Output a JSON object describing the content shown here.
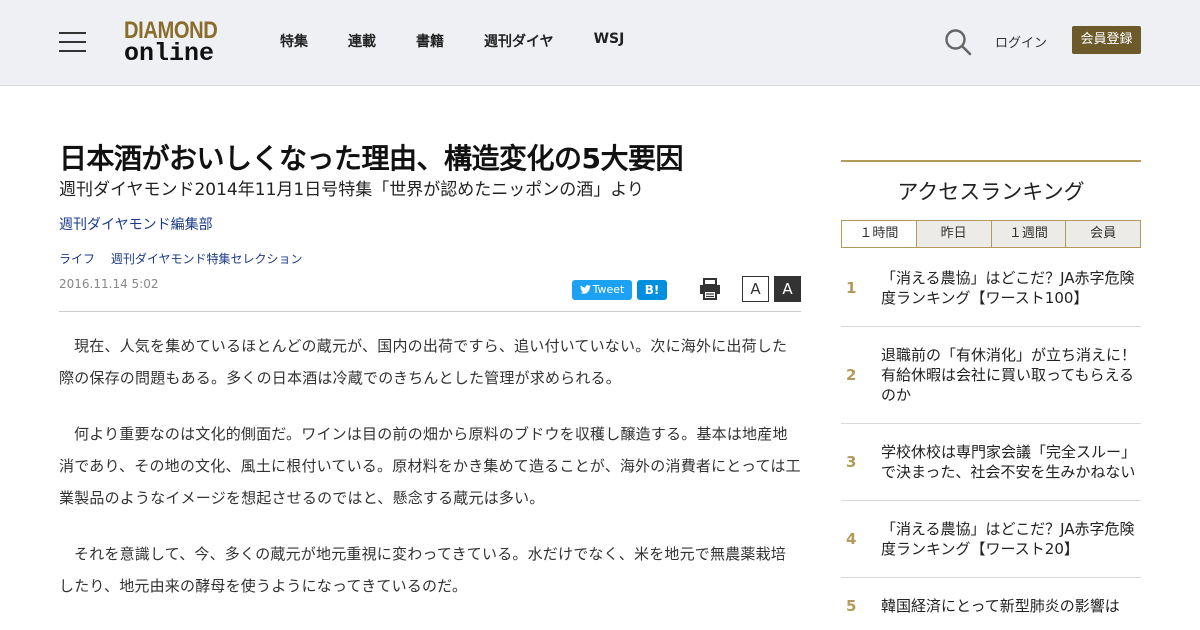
{
  "header": {
    "logo_top": "DIAMOND",
    "logo_bottom": "online",
    "nav": [
      "特集",
      "連載",
      "書籍",
      "週刊ダイヤ",
      "WSJ"
    ],
    "login": "ログイン",
    "register": "会員登録"
  },
  "article": {
    "title": "日本酒がおいしくなった理由、構造変化の5大要因",
    "subtitle": "週刊ダイヤモンド2014年11月1日号特集「世界が認めたニッポンの酒」より",
    "author": "週刊ダイヤモンド編集部",
    "categories": [
      "ライフ",
      "週刊ダイヤモンド特集セレクション"
    ],
    "date": "2016.11.14 5:02",
    "tweet_label": "Tweet",
    "hatena_label": "B!",
    "font_small_label": "A",
    "font_large_label": "A",
    "paragraphs": [
      "現在、人気を集めているほとんどの蔵元が、国内の出荷ですら、追い付いていない。次に海外に出荷した際の保存の問題もある。多くの日本酒は冷蔵でのきちんとした管理が求められる。",
      "何より重要なのは文化的側面だ。ワインは目の前の畑から原料のブドウを収穫し醸造する。基本は地産地消であり、その地の文化、風土に根付いている。原材料をかき集めて造ることが、海外の消費者にとっては工業製品のようなイメージを想起させるのではと、懸念する蔵元は多い。",
      "それを意識して、今、多くの蔵元が地元重視に変わってきている。水だけでなく、米を地元で無農薬栽培したり、地元由来の酵母を使うようになってきているのだ。"
    ]
  },
  "sidebar": {
    "title": "アクセスランキング",
    "tabs": [
      "１時間",
      "昨日",
      "１週間",
      "会員"
    ],
    "ranking": [
      {
        "num": "1",
        "text": "「消える農協」はどこだ？JA赤字危険度ランキング【ワースト100】"
      },
      {
        "num": "2",
        "text": "退職前の「有休消化」が立ち消えに！有給休暇は会社に買い取ってもらえるのか"
      },
      {
        "num": "3",
        "text": "学校休校は専門家会議「完全スルー」で決まった、社会不安を生みかねない"
      },
      {
        "num": "4",
        "text": "「消える農協」はどこだ？JA赤字危険度ランキング【ワースト20】"
      },
      {
        "num": "5",
        "text": "韓国経済にとって新型肺炎の影響は"
      }
    ]
  },
  "colors": {
    "accent": "#b39a5a",
    "register_bg": "#6d5a2b",
    "link": "#1a3a8a",
    "twitter": "#1da1f2",
    "hatena": "#008fde"
  }
}
